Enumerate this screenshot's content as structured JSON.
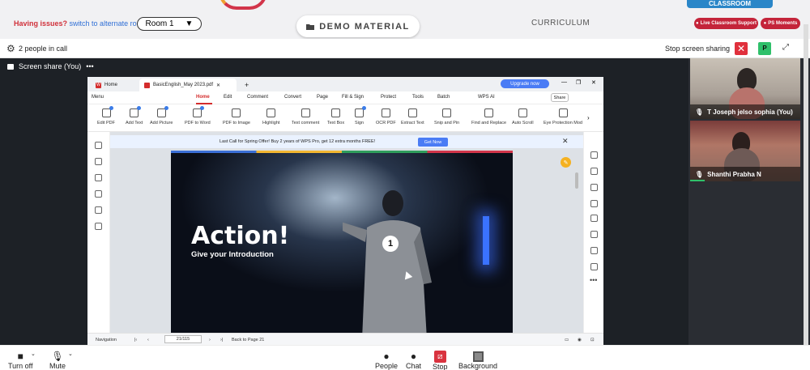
{
  "topbar": {
    "issues_question": "Having issues?",
    "issues_link": "switch to alternate room",
    "room_label": "Room 1",
    "room_caret": "▼",
    "demo_label": "DEMO MATERIAL",
    "curriculum_label": "CURRICULUM",
    "classroom_badge": "CLASSROOM",
    "live_support_label": "Live Classroom Support",
    "ps_moments_label": "PS Moments"
  },
  "callbar": {
    "people_count_label": "2 people in call",
    "stop_sharing_label": "Stop screen sharing",
    "stop_x": "✕",
    "participant_initial": "P",
    "expand_icon": "⤢"
  },
  "stage": {
    "share_label": "Screen share (You)",
    "more": "•••"
  },
  "participants": [
    {
      "name": "T Joseph jelso sophia (You)"
    },
    {
      "name": "Shanthi Prabha N"
    }
  ],
  "wps": {
    "tabs": [
      {
        "label": "Home"
      },
      {
        "label": "BasicEnglish_May 2023.pdf"
      }
    ],
    "new_tab": "+",
    "upgrade_label": "Upgrade now",
    "menu": {
      "menu_label": "Menu",
      "items": [
        "Home",
        "Edit",
        "Comment",
        "Convert",
        "Page",
        "Fill & Sign",
        "Protect",
        "Tools",
        "Batch",
        "WPS AI"
      ],
      "share_label": "Share"
    },
    "toolbar": [
      "Edit PDF",
      "Add Text",
      "Add Picture",
      "PDF to Word",
      "PDF to Image",
      "Highlight",
      "Text comment",
      "Text Box",
      "Sign",
      "OCR PDF",
      "Extract Text",
      "Snip and Pin",
      "Find and Replace",
      "Auto Scroll",
      "Eye Protection Mod"
    ],
    "promo_text": "Last Call for Spring Offer! Buy 2 years of WPS Pro, get 12 extra months FREE!",
    "promo_button": "Get Now",
    "promo_close": "✕",
    "slide": {
      "title": "Action!",
      "subtitle": "Give your Introduction",
      "number": "1"
    },
    "status": {
      "navigation_label": "Navigation",
      "page_value": "21/115",
      "back_label": "Back to Page 21"
    }
  },
  "bottombar": {
    "turn_off": "Turn off",
    "mute": "Mute",
    "people": "People",
    "chat": "Chat",
    "stop": "Stop",
    "background": "Background"
  },
  "colors": {
    "accent_red": "#d42c2c",
    "call_green": "#2fc06a",
    "classroom_blue": "#2a86c8",
    "pill_red": "#c4243a",
    "upgrade_blue": "#4a7cf5"
  }
}
